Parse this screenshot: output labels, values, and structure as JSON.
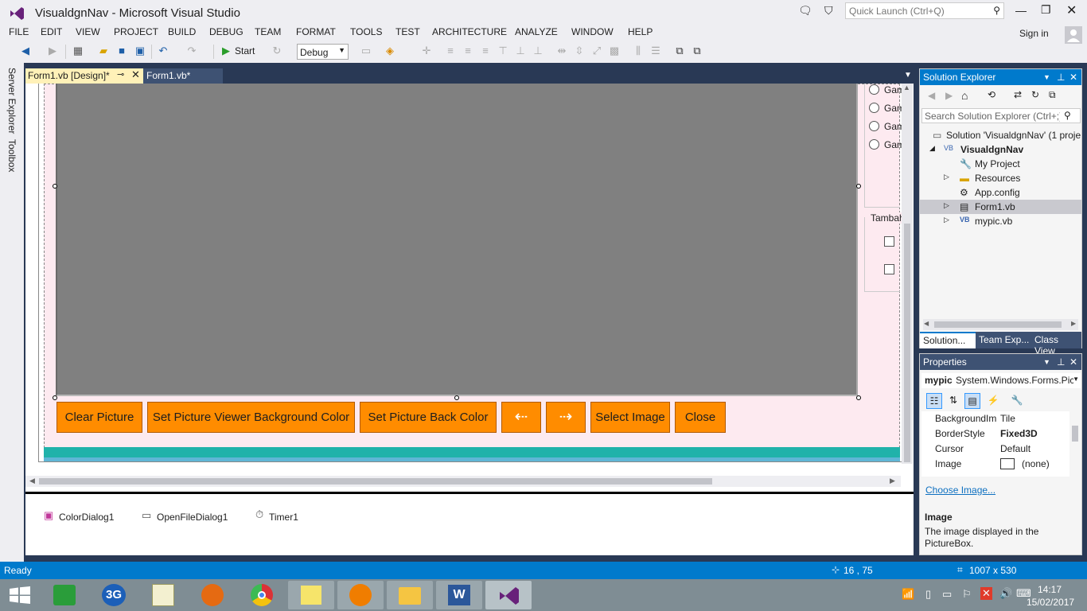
{
  "window": {
    "title": "VisualdgnNav - Microsoft Visual Studio"
  },
  "titlebar": {
    "quick_launch_placeholder": "Quick Launch (Ctrl+Q)",
    "sign_in": "Sign in"
  },
  "menu": [
    "FILE",
    "EDIT",
    "VIEW",
    "PROJECT",
    "BUILD",
    "DEBUG",
    "TEAM",
    "FORMAT",
    "TOOLS",
    "TEST",
    "ARCHITECTURE",
    "ANALYZE",
    "WINDOW",
    "HELP"
  ],
  "toolbar": {
    "start_label": "Start",
    "config": "Debug"
  },
  "side_tabs": [
    "Server Explorer",
    "Toolbox"
  ],
  "doc_tabs": [
    {
      "label": "Form1.vb [Design]*",
      "active": true
    },
    {
      "label": "Form1.vb*",
      "active": false
    }
  ],
  "form": {
    "buttons": [
      "Clear Picture",
      "Set Picture Viewer Background Color",
      "Set Picture Back Color",
      "⇠",
      "⇢",
      "Select Image",
      "Close"
    ],
    "radios": [
      "Gam",
      "Gam",
      "Gam",
      "Gam"
    ],
    "group_label": "Tambah"
  },
  "tray": [
    "ColorDialog1",
    "OpenFileDialog1",
    "Timer1"
  ],
  "solution_explorer": {
    "title": "Solution Explorer",
    "search_placeholder": "Search Solution Explorer (Ctrl+;)",
    "items": [
      {
        "label": "Solution 'VisualdgnNav' (1 proje"
      },
      {
        "label": "VisualdgnNav"
      },
      {
        "label": "My Project"
      },
      {
        "label": "Resources"
      },
      {
        "label": "App.config"
      },
      {
        "label": "Form1.vb"
      },
      {
        "label": "mypic.vb"
      }
    ],
    "tabs": [
      "Solution...",
      "Team Exp...",
      "Class View"
    ]
  },
  "properties": {
    "title": "Properties",
    "object": "mypic",
    "object_type": "System.Windows.Forms.Pic",
    "rows": [
      {
        "name": "BackgroundIm",
        "value": "Tile"
      },
      {
        "name": "BorderStyle",
        "value": "Fixed3D"
      },
      {
        "name": "Cursor",
        "value": "Default"
      },
      {
        "name": "Image",
        "value": "(none)"
      }
    ],
    "link": "Choose Image...",
    "desc_title": "Image",
    "desc_text": "The image displayed in the PictureBox."
  },
  "status": {
    "text": "Ready",
    "position": "16 , 75",
    "size": "1007 x 530"
  },
  "clock": {
    "time": "14:17",
    "date": "15/02/2017"
  },
  "colors": {
    "accent": "#007acc",
    "orange": "#ff8c00",
    "picture": "#808080",
    "form_bg": "#fdeaf0"
  }
}
